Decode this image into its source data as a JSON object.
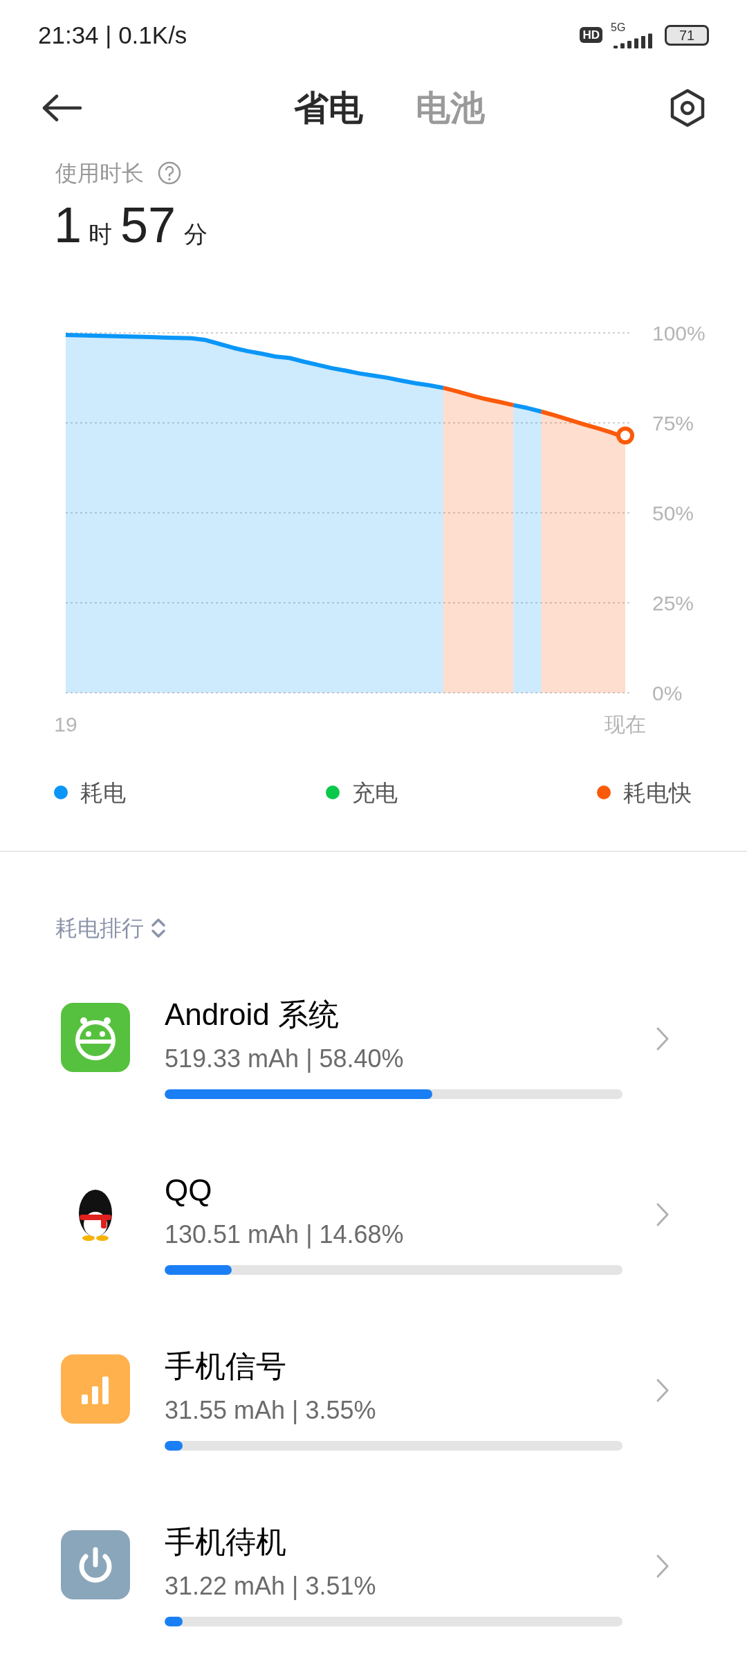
{
  "status_bar": {
    "time_speed": "21:34 | 0.1K/s",
    "hd": "HD",
    "network": "5G",
    "battery": "71"
  },
  "header": {
    "tabs": [
      {
        "label": "省电",
        "selected": true
      },
      {
        "label": "电池",
        "selected": false
      }
    ]
  },
  "usage": {
    "label": "使用时长",
    "hours": "1",
    "hours_unit": "时",
    "minutes": "57",
    "minutes_unit": "分"
  },
  "chart_data": {
    "type": "area",
    "grid": true,
    "categories": [
      "19",
      null,
      null,
      null,
      null,
      null,
      null,
      null,
      null,
      null,
      null,
      null,
      null,
      null,
      null,
      null,
      null,
      null,
      null,
      null,
      null,
      null,
      null,
      null,
      null,
      null,
      null,
      null,
      null,
      null,
      null,
      null,
      null,
      null,
      null,
      null,
      null,
      null,
      null,
      null,
      "现在"
    ],
    "series": [
      {
        "name": "耗电",
        "color": "#0a96f7",
        "values": [
          100,
          99.9,
          99.8,
          99.7,
          99.6,
          99.5,
          99.4,
          99.3,
          99.2,
          99.1,
          98.6,
          97.5,
          96.4,
          95.5,
          94.8,
          94.0,
          93.6,
          92.6,
          91.7,
          90.8,
          90.1,
          89.3,
          88.7,
          88.1,
          87.3,
          86.6,
          86.0,
          85.3,
          null,
          null,
          null,
          null,
          80.5,
          79.7,
          78.7,
          null,
          null,
          null,
          null,
          null,
          null
        ]
      },
      {
        "name": "充电",
        "color": "#0ac84a",
        "values": [
          null,
          null,
          null,
          null,
          null,
          null,
          null,
          null,
          null,
          null,
          null,
          null,
          null,
          null,
          null,
          null,
          null,
          null,
          null,
          null,
          null,
          null,
          null,
          null,
          null,
          null,
          null,
          null,
          null,
          null,
          null,
          null,
          null,
          null,
          null,
          null,
          null,
          null,
          null,
          null,
          null
        ]
      },
      {
        "name": "耗电快",
        "color": "#fa5a0a",
        "values": [
          null,
          null,
          null,
          null,
          null,
          null,
          null,
          null,
          null,
          null,
          null,
          null,
          null,
          null,
          null,
          null,
          null,
          null,
          null,
          null,
          null,
          null,
          null,
          null,
          null,
          null,
          null,
          85.3,
          84.3,
          83.2,
          82.2,
          81.4,
          80.5,
          null,
          78.7,
          77.6,
          76.4,
          75.2,
          74.1,
          72.9,
          71.5
        ]
      }
    ],
    "ylim": [
      0,
      100
    ],
    "yticks": [
      {
        "value": 100,
        "label": "100%"
      },
      {
        "value": 75,
        "label": "75%"
      },
      {
        "value": 50,
        "label": "50%"
      },
      {
        "value": 25,
        "label": "25%"
      },
      {
        "value": 0,
        "label": "0%"
      }
    ]
  },
  "ranking": {
    "title": "耗电排行",
    "items": [
      {
        "kind": "android",
        "name": "Android 系统",
        "detail": "519.33 mAh | 58.40%",
        "level": 0.584
      },
      {
        "kind": "penguin",
        "name": "QQ",
        "detail": "130.51 mAh | 14.68%",
        "level": 0.1468
      },
      {
        "kind": "signal",
        "name": "手机信号",
        "detail": "31.55 mAh | 3.55%",
        "level": 0.0355
      },
      {
        "kind": "standby",
        "name": "手机待机",
        "detail": "31.22 mAh | 3.51%",
        "level": 0.0351
      }
    ]
  }
}
